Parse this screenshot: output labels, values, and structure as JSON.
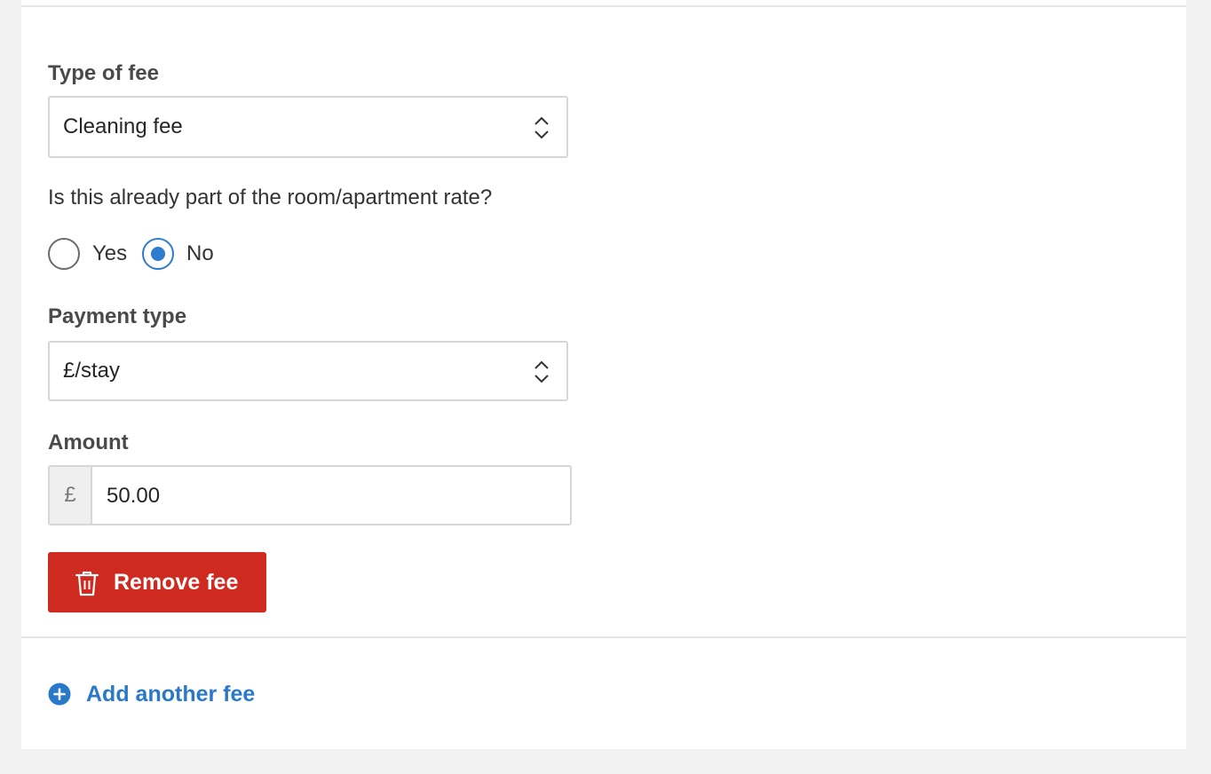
{
  "fee_type": {
    "label": "Type of fee",
    "selected": "Cleaning fee"
  },
  "included_question": {
    "text": "Is this already part of the room/apartment rate?",
    "options": [
      {
        "label": "Yes",
        "selected": false
      },
      {
        "label": "No",
        "selected": true
      }
    ]
  },
  "payment_type": {
    "label": "Payment type",
    "selected": "£/stay"
  },
  "amount": {
    "label": "Amount",
    "currency_symbol": "£",
    "value": "50.00"
  },
  "actions": {
    "remove_label": "Remove fee",
    "add_label": "Add another fee"
  },
  "colors": {
    "danger": "#cf2a20",
    "link": "#2a78c8",
    "radio_selected": "#2f7bd0"
  }
}
